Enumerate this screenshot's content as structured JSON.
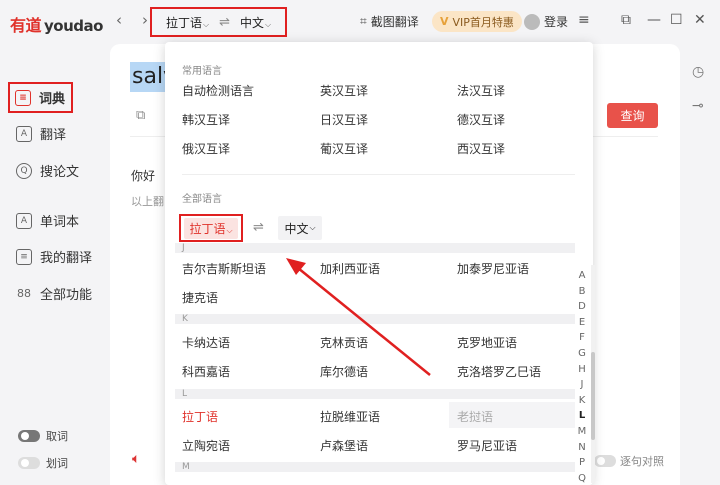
{
  "app": {
    "logo_cn": "有道",
    "logo_en": "youdao"
  },
  "titlebar": {
    "back": "‹",
    "forward": "›",
    "source_lang": "拉丁语",
    "swap": "⇌",
    "target_lang": "中文",
    "screenshot_translate": "截图翻译",
    "vip_label": "VIP首月特惠",
    "login": "登录",
    "menu": "≡",
    "restore": "⧉",
    "minimize": "—",
    "maximize": "☐",
    "close": "✕"
  },
  "sidebar": {
    "items": [
      {
        "label": "词典",
        "icon": "dictionary-icon",
        "glyph": "≡"
      },
      {
        "label": "翻译",
        "icon": "translate-icon",
        "glyph": "A"
      },
      {
        "label": "搜论文",
        "icon": "paper-search-icon",
        "glyph": "Q"
      },
      {
        "label": "单词本",
        "icon": "wordbook-icon",
        "glyph": "A"
      },
      {
        "label": "我的翻译",
        "icon": "my-translation-icon",
        "glyph": "≡"
      },
      {
        "label": "全部功能",
        "icon": "all-features-icon",
        "glyph": "88"
      }
    ],
    "toggles": [
      {
        "label": "取词",
        "state": "on"
      },
      {
        "label": "划词",
        "state": "off"
      }
    ]
  },
  "main": {
    "query_text": "salv",
    "search_button": "查询",
    "result_line1": "你好",
    "result_line2": "以上翻",
    "bilingual_label": "逐句对照"
  },
  "dropdown": {
    "common_title": "常用语言",
    "common": [
      [
        "自动检测语言",
        "英汉互译",
        "法汉互译"
      ],
      [
        "韩汉互译",
        "日汉互译",
        "德汉互译"
      ],
      [
        "俄汉互译",
        "葡汉互译",
        "西汉互译"
      ]
    ],
    "all_title": "全部语言",
    "source_selected": "拉丁语",
    "swap": "⇌",
    "target_selected": "中文",
    "groups": {
      "J": [
        "吉尔吉斯斯坦语",
        "加利西亚语",
        "加泰罗尼亚语",
        "捷克语"
      ],
      "K": [
        "卡纳达语",
        "克林贡语",
        "克罗地亚语",
        "科西嘉语",
        "库尔德语",
        "克洛塔罗乙巳语"
      ],
      "L": [
        "拉丁语",
        "拉脱维亚语",
        "老挝语",
        "立陶宛语",
        "卢森堡语",
        "罗马尼亚语"
      ],
      "M": []
    },
    "group_labels": [
      "J",
      "K",
      "L",
      "M"
    ],
    "alphabet": [
      "A",
      "B",
      "D",
      "E",
      "F",
      "G",
      "H",
      "J",
      "K",
      "L",
      "M",
      "N",
      "P",
      "Q"
    ],
    "alphabet_current": "L"
  },
  "colors": {
    "brand_red": "#e0322b",
    "annotation_red": "#e02020",
    "search_button": "#e8524a",
    "vip_bg": "#fbe5c6"
  }
}
